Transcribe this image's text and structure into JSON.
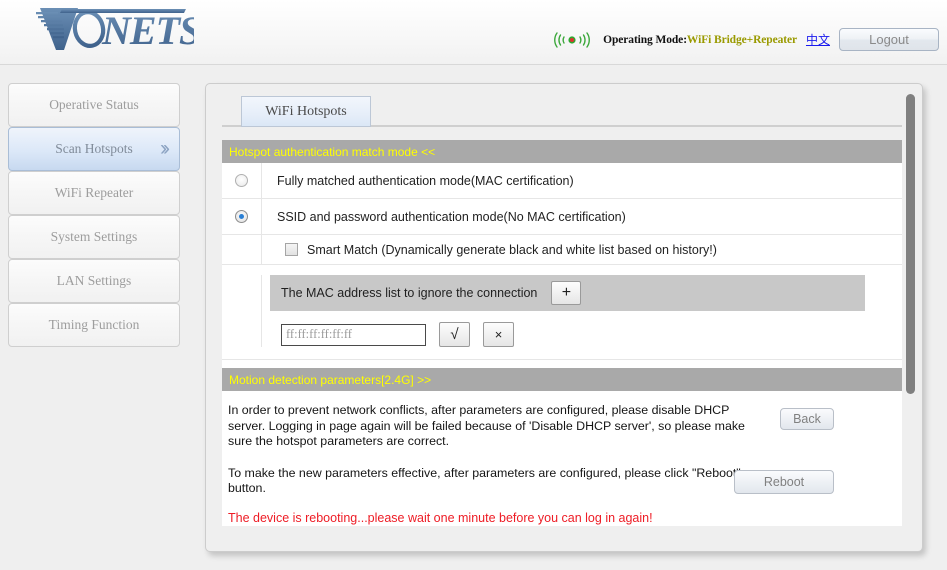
{
  "header": {
    "logo_text": "VONETS",
    "signal_icon": "wifi-signal-icon",
    "operating_mode_label": "Operating Mode:",
    "operating_mode_value": "WiFi Bridge+Repeater",
    "lang_link": "中文",
    "logout_label": "Logout"
  },
  "sidebar": {
    "items": [
      {
        "label": "Operative Status",
        "active": false
      },
      {
        "label": "Scan Hotspots",
        "active": true,
        "chevron": "»"
      },
      {
        "label": "WiFi Repeater",
        "active": false
      },
      {
        "label": "System Settings",
        "active": false
      },
      {
        "label": "LAN Settings",
        "active": false
      },
      {
        "label": "Timing Function",
        "active": false
      }
    ]
  },
  "tabs": [
    {
      "label": "WiFi Hotspots",
      "active": true
    }
  ],
  "auth_section": {
    "title": "Hotspot authentication match mode <<",
    "options": [
      {
        "label": "Fully matched authentication mode(MAC certification)",
        "selected": false
      },
      {
        "label": "SSID and password authentication mode(No MAC certification)",
        "selected": true
      }
    ],
    "smart_match": {
      "label": "Smart Match (Dynamically generate black and white list based on history!)",
      "checked": false
    },
    "mac_list": {
      "title": "The MAC address list to ignore the connection",
      "add_button": "+",
      "input_value": "",
      "input_placeholder": "ff:ff:ff:ff:ff:ff",
      "confirm_button": "√",
      "delete_button": "×"
    }
  },
  "motion_section": {
    "title": "Motion detection parameters[2.4G] >>"
  },
  "notes": {
    "dhcp_note": "In order to prevent network conflicts, after parameters are configured, please disable DHCP server. Logging in page again will be failed because of 'Disable DHCP server', so please make sure the hotspot parameters are correct.",
    "back_button": "Back",
    "reboot_note": "To make the new parameters effective, after parameters are configured, please click \"Reboot\" button.",
    "reboot_button": "Reboot",
    "alert": "The device is rebooting...please wait one minute before you can log in again!"
  },
  "colors": {
    "section_bar_bg": "#a9a9a9",
    "section_bar_text": "#ffff00",
    "alert_text": "#ee1c25",
    "accent_blue": "#2a7fd4",
    "mode_value": "#9a9a00",
    "link": "#1a1aee",
    "page_bg": "#efefef"
  },
  "scrollbar": {
    "orientation": "vertical",
    "thumb_position": "top"
  }
}
